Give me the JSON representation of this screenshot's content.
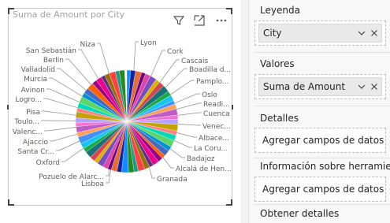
{
  "visual": {
    "title": "Suma de Amount por City",
    "filter_icon": "filter-icon",
    "focus_icon": "focus-mode-icon",
    "more_icon": "more-options-icon"
  },
  "chart_data": {
    "type": "pie",
    "title": "Suma de Amount por City",
    "slice_labels": [
      "Lyon",
      "Cork",
      "Cascais",
      "Boadilla d...",
      "Pamplo...",
      "Oslo",
      "Readi...",
      "Cuenca",
      "Venec...",
      "Albace...",
      "La Coru...",
      "Badajoz",
      "Alcalá de Hen...",
      "Granada",
      "Lisboa",
      "Pozuelo de Alarc...",
      "Oxford",
      "Santa Cr...",
      "Ajaccio",
      "Valenc...",
      "Toulo...",
      "Pisa",
      "Logro...",
      "Avinon",
      "Murcia",
      "Valladolid",
      "Berlin",
      "San Sebastián",
      "Niza"
    ],
    "slice_count_approx": 60
  },
  "pane": {
    "legend": {
      "title": "Leyenda",
      "field": "City"
    },
    "values": {
      "title": "Valores",
      "field": "Suma de Amount"
    },
    "details": {
      "title": "Detalles",
      "placeholder": "Agregar campos de datos a..."
    },
    "tooltips": {
      "title": "Información sobre herramien...",
      "placeholder": "Agregar campos de datos a..."
    },
    "drillthrough": {
      "title": "Obtener detalles"
    }
  },
  "colors": {
    "accent_teal": "#118dff",
    "pie_palette": [
      "#118DFF",
      "#12239E",
      "#E66C37",
      "#6B007B",
      "#E044A7",
      "#744EC2",
      "#D9B300",
      "#D64550",
      "#197278",
      "#1AAB40",
      "#15C6F4",
      "#4092FF",
      "#FFA058",
      "#BE5DC9",
      "#F472D0",
      "#B5A1FF",
      "#C4A200",
      "#FF8080",
      "#00DBBC",
      "#5BD667",
      "#0091D5",
      "#4668C5",
      "#FF6300",
      "#99008A",
      "#EC008C",
      "#533285",
      "#99700A",
      "#FF4141",
      "#1F9A85",
      "#25891C"
    ]
  }
}
